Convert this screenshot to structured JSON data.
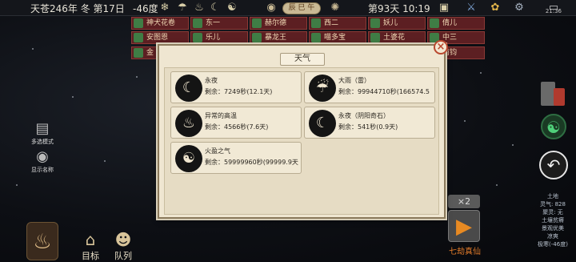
{
  "topbar": {
    "date": "天苍246年 冬 第17日",
    "temperature": "-46度",
    "time_badge": "辰 巳 午",
    "day_time": "第93天 10:19",
    "clock": "21:36"
  },
  "npc_rows": [
    [
      "神犬花卷",
      "东一",
      "赫尔德",
      "西二",
      "妖儿",
      "倩儿"
    ],
    [
      "安图恩",
      "乐儿",
      "暴龙王",
      "喵多宝",
      "土婆花",
      "中三"
    ],
    [
      "金",
      "",
      "",
      "",
      "",
      "南钧"
    ]
  ],
  "left_controls": {
    "multi_select": "多选模式",
    "show_names": "显示名称"
  },
  "bottom_nav": {
    "target": "目标",
    "team": "队列"
  },
  "modal": {
    "title": "天气",
    "close": "×",
    "weather": [
      {
        "name": "永夜",
        "remaining": "剩余：7249秒(12.1天)",
        "icon": "moon-icon",
        "glyph": "☾"
      },
      {
        "name": "大雨（雷）",
        "remaining": "剩余：99944710秒(166574.5",
        "icon": "thunder-rain-icon",
        "glyph": "☔"
      },
      {
        "name": "异常的高温",
        "remaining": "剩余：4566秒(7.6天)",
        "icon": "heat-icon",
        "glyph": "♨"
      },
      {
        "name": "永夜（阴阳奇石）",
        "remaining": "剩余：541秒(0.9天)",
        "icon": "moon-icon",
        "glyph": "☾"
      },
      {
        "name": "火盈之气",
        "remaining": "剩余：59999960秒(99999.9天",
        "icon": "fire-qi-icon",
        "glyph": "☯"
      }
    ]
  },
  "right_panel": {
    "speed": "×2",
    "play_label": "七劫真仙",
    "info_lines": [
      "土地",
      "灵气: 828",
      "聚灵: 无",
      "土壤贫瘠",
      "景观优美",
      "凉爽",
      "极寒(-46度)"
    ]
  },
  "colors": {
    "modal_bg": "#efe6d1",
    "npc_bg": "#5c1f22",
    "accent": "#e07a2a"
  }
}
